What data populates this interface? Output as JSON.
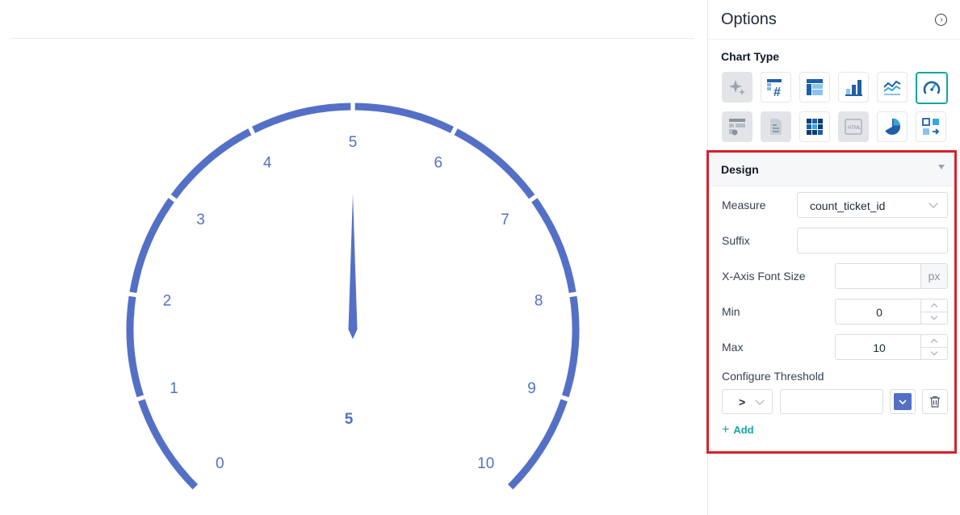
{
  "gauge": {
    "min": 0,
    "max": 10,
    "value": 5,
    "tick_labels": [
      "0",
      "1",
      "2",
      "3",
      "4",
      "5",
      "6",
      "7",
      "8",
      "9",
      "10"
    ],
    "value_label": "5",
    "color": "#5470c6"
  },
  "options": {
    "title": "Options",
    "collapse_icon": "chevron-right-circle-icon",
    "chart_type_label": "Chart Type",
    "chart_types": [
      {
        "icon": "sparkle-icon",
        "state": "disabled"
      },
      {
        "icon": "table-number-icon",
        "state": "normal"
      },
      {
        "icon": "table-icon",
        "state": "normal"
      },
      {
        "icon": "bar-chart-icon",
        "state": "normal"
      },
      {
        "icon": "line-chart-icon",
        "state": "normal"
      },
      {
        "icon": "gauge-icon",
        "state": "selected"
      },
      {
        "icon": "table-settings-icon",
        "state": "disabled"
      },
      {
        "icon": "document-icon",
        "state": "disabled"
      },
      {
        "icon": "heatmap-icon",
        "state": "normal"
      },
      {
        "icon": "html-icon",
        "state": "disabled"
      },
      {
        "icon": "pie-chart-icon",
        "state": "normal"
      },
      {
        "icon": "custom-chart-icon",
        "state": "normal"
      }
    ]
  },
  "design": {
    "title": "Design",
    "measure_label": "Measure",
    "measure_value": "count_ticket_id",
    "suffix_label": "Suffix",
    "suffix_value": "",
    "xaxis_font_label": "X-Axis Font Size",
    "xaxis_font_value": "",
    "xaxis_font_unit": "px",
    "min_label": "Min",
    "min_value": "0",
    "max_label": "Max",
    "max_value": "10",
    "threshold_label": "Configure Threshold",
    "threshold_operator": ">",
    "threshold_value": "",
    "threshold_color": "#5470c6",
    "add_label": "Add"
  },
  "colors": {
    "accent": "#14a6a6",
    "highlight": "#d9202a"
  }
}
